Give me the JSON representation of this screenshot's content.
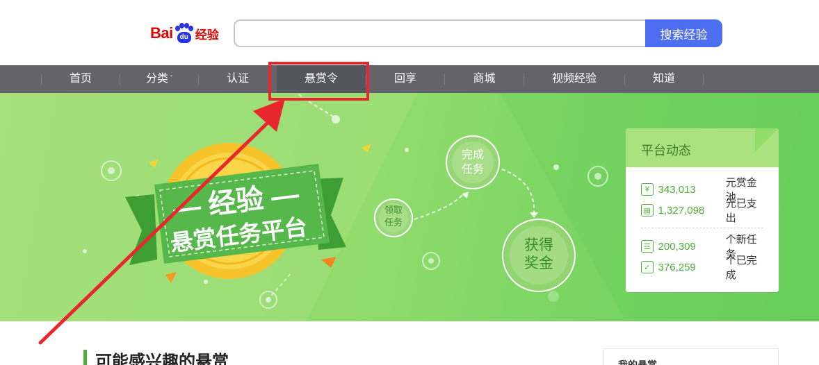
{
  "header": {
    "logo": {
      "brand_part1": "Bai",
      "brand_paw": "du",
      "brand_part2": "经验"
    },
    "search": {
      "value": "",
      "placeholder": "",
      "button_label": "搜索经验"
    }
  },
  "nav": {
    "items": [
      {
        "label": "首页"
      },
      {
        "label": "分类",
        "has_dropdown": true,
        "chevron": "ˇ"
      },
      {
        "label": "认证"
      },
      {
        "label": "悬赏令",
        "active": true
      },
      {
        "label": "回享"
      },
      {
        "label": "商城"
      },
      {
        "label": "视频经验"
      },
      {
        "label": "知道"
      }
    ]
  },
  "banner": {
    "ribbon_title": "— 经验 —",
    "ribbon_subtitle": "悬赏任务平台",
    "flow": {
      "step1": "领取\n任务",
      "step2": "完成\n任务",
      "step3": "获得\n奖金"
    },
    "card": {
      "title": "平台动态",
      "stats": [
        {
          "icon": "yen-icon",
          "glyph": "¥",
          "value": "343,013",
          "label": "元赏金池"
        },
        {
          "icon": "wallet-icon",
          "glyph": "▤",
          "value": "1,327,098",
          "label": "元已支出"
        },
        {
          "icon": "task-list-icon",
          "glyph": "☰",
          "value": "200,309",
          "label": "个新任务"
        },
        {
          "icon": "check-icon",
          "glyph": "✓",
          "value": "376,259",
          "label": "个已完成"
        }
      ]
    }
  },
  "section": {
    "title": "可能感兴趣的悬赏"
  },
  "sidebar": {
    "title": "我的悬赏"
  },
  "colors": {
    "nav_bg": "#636369",
    "search_button": "#4e6ef2",
    "accent_green": "#4caf36",
    "annotation_red": "#e8262e"
  }
}
